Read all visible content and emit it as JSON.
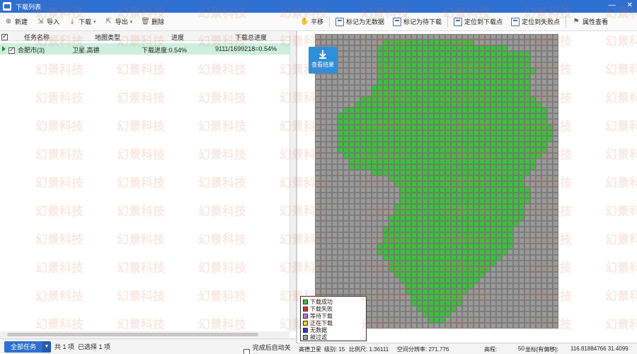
{
  "window": {
    "title": "下载列表",
    "minimize": "—",
    "close": "✕"
  },
  "left_toolbar": {
    "new_label": "新建",
    "import_label": "导入",
    "download_label": "下载",
    "export_label": "导出",
    "delete_label": "删除"
  },
  "right_toolbar": {
    "pan_label": "平移",
    "mark_nodata_label": "标记为无数据",
    "mark_pending_label": "标记为待下载",
    "locate_download_label": "定位到下载点",
    "locate_failed_label": "定位到失败点",
    "properties_label": "属性查看"
  },
  "list": {
    "columns": [
      "任务名称",
      "地图类型",
      "进度",
      "下载总进度"
    ],
    "rows": [
      {
        "name": "合肥市(3)",
        "map_type": "卫星.高德",
        "progress": "下载进度:0.54%",
        "total": "9111/1699218=0.54%"
      }
    ]
  },
  "status_left": {
    "all_tasks_label": "全部任务",
    "total_count": "共 1 项",
    "selected_count": "已选择 1 项",
    "auto_shutdown_label": "完成后自动关机"
  },
  "view_result_label": "查看结果",
  "legend": [
    {
      "label": "下载成功",
      "color": "#3ec03e"
    },
    {
      "label": "下载失败",
      "color": "#e03030"
    },
    {
      "label": "等待下载",
      "color": "#c070e0"
    },
    {
      "label": "正在下载",
      "color": "#f0e030"
    },
    {
      "label": "无数据",
      "color": "#3030c0"
    },
    {
      "label": "被过滤",
      "color": "#a0a0a0"
    }
  ],
  "status_right": {
    "map_name": "高德卫星",
    "level": "级别: 15",
    "scale": "比例尺: 1:36111",
    "resolution": "空间分辨率: 271.776",
    "elevation_label": "高程:",
    "elevation_value": "50",
    "coord_label": "坐标[有偏移]:",
    "coord_value": "116.81884766  31.4099"
  },
  "watermark_text": "幻景科技",
  "colors": {
    "accent": "#2f6fd0",
    "row_selected": "#cdeee0",
    "tile_ok": "#3ec03e",
    "tile_filtered": "#a0a0a0"
  }
}
